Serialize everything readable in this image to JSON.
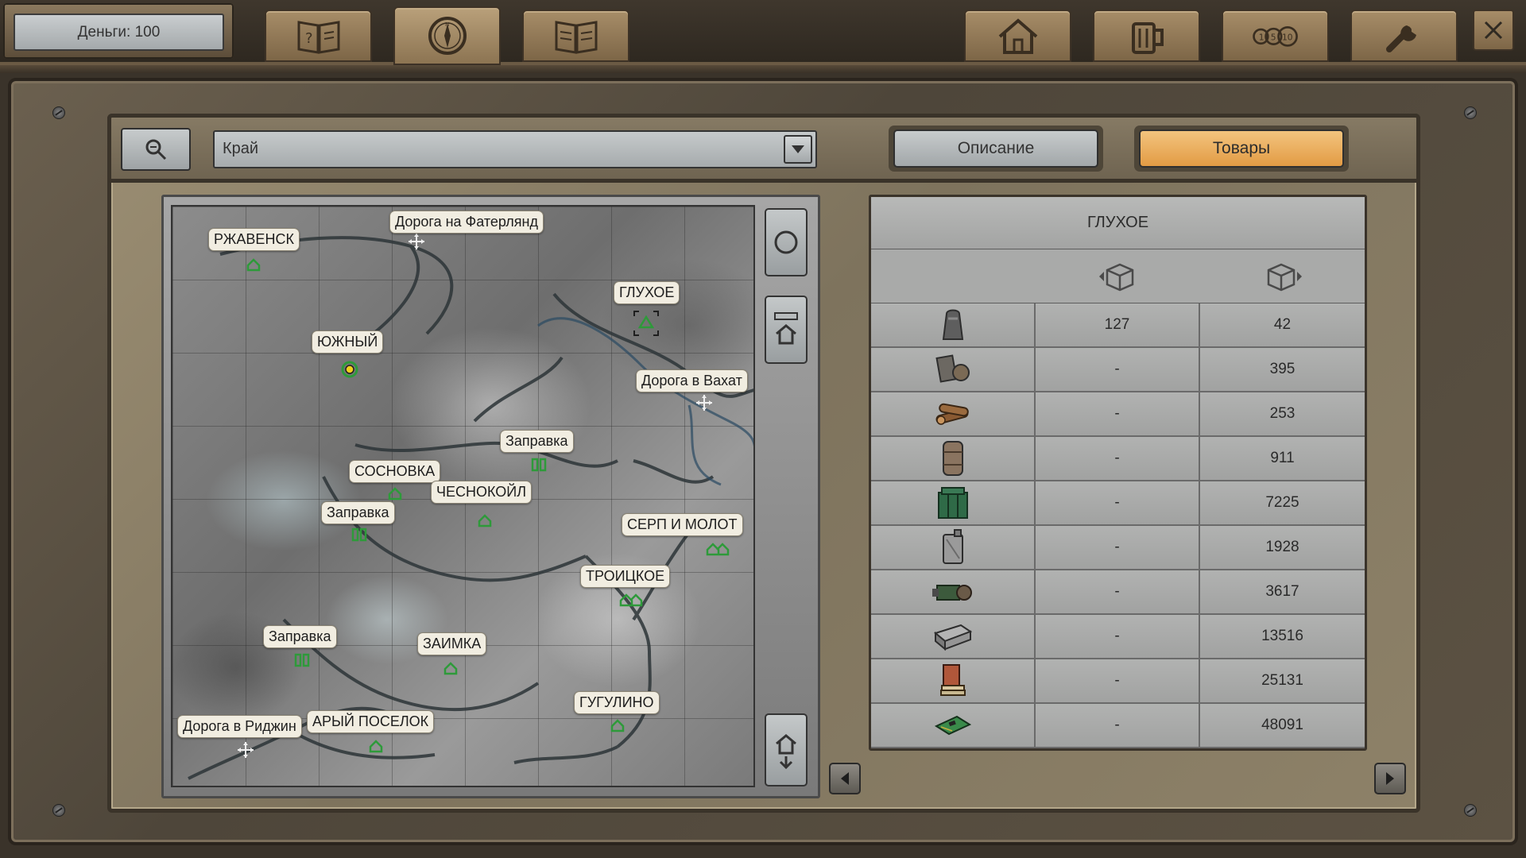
{
  "top_bar": {
    "money": "Деньги: 100",
    "tabs": [
      {
        "icon": "quest-book-icon"
      },
      {
        "icon": "compass-icon",
        "active": true
      },
      {
        "icon": "journal-book-icon"
      }
    ],
    "right_buttons": [
      {
        "icon": "home-icon"
      },
      {
        "icon": "beer-mug-icon"
      },
      {
        "icon": "coins-icon"
      },
      {
        "icon": "wrench-icon"
      }
    ],
    "close_icon": "close-icon"
  },
  "toolbar": {
    "region_value": "Край",
    "description_button": "Описание",
    "goods_button": "Товары",
    "accent_color": "#f0b05e"
  },
  "map": {
    "labels": {
      "rzhavensk": "РЖАВЕНСК",
      "road_faterland": "Дорога на Фатерлянд",
      "glukhoe": "ГЛУХОЕ",
      "yuzhny": "ЮЖНЫЙ",
      "road_vakhat": "Дорога в Вахат",
      "gas_1": "Заправка",
      "sosnovka": "СОСНОВКА",
      "chesnokoil": "ЧЕСНОКОЙЛ",
      "gas_2": "Заправка",
      "serp_molot": "СЕРП И МОЛОТ",
      "troitskoe": "ТРОИЦКОЕ",
      "gas_3": "Заправка",
      "zaimka": "ЗАИМКА",
      "gugulino": "ГУГУЛИНО",
      "road_ridzhin": "Дорога в Риджин",
      "stary_poselok": "АРЫЙ ПОСЕЛОК"
    }
  },
  "goods": {
    "location": "ГЛУХОЕ",
    "rows": [
      {
        "icon": "bag-icon",
        "buy": "127",
        "sell": "42"
      },
      {
        "icon": "scrap-metal-icon",
        "buy": "-",
        "sell": "395"
      },
      {
        "icon": "firewood-icon",
        "buy": "-",
        "sell": "253"
      },
      {
        "icon": "barrel-icon",
        "buy": "-",
        "sell": "911"
      },
      {
        "icon": "crate-icon",
        "buy": "-",
        "sell": "7225"
      },
      {
        "icon": "canister-icon",
        "buy": "-",
        "sell": "1928"
      },
      {
        "icon": "engine-icon",
        "buy": "-",
        "sell": "3617"
      },
      {
        "icon": "metal-box-icon",
        "buy": "-",
        "sell": "13516"
      },
      {
        "icon": "books-icon",
        "buy": "-",
        "sell": "25131"
      },
      {
        "icon": "circuit-board-icon",
        "buy": "-",
        "sell": "48091"
      }
    ]
  }
}
